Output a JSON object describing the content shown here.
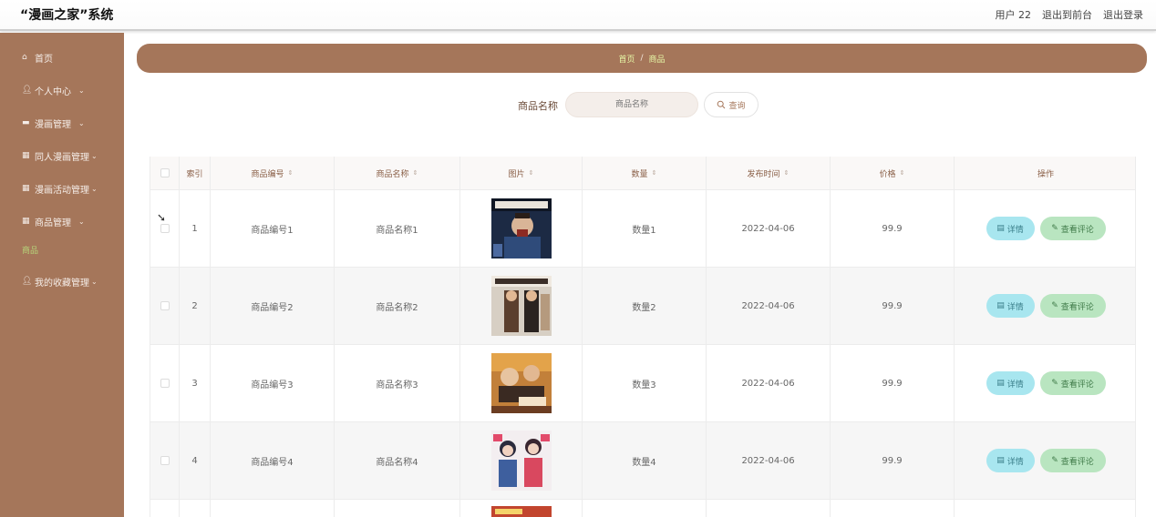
{
  "header": {
    "app_title": "“漫画之家”系统",
    "user_label": "用户 22",
    "back_to_admin": "退出到前台",
    "logout": "退出登录"
  },
  "sidebar": {
    "items": [
      {
        "label": "首页",
        "icon": "home-icon"
      },
      {
        "label": "个人中心",
        "icon": "user-icon",
        "chevron": "﹀"
      },
      {
        "label": "漫画管理",
        "icon": "book-icon",
        "chevron": "﹀"
      },
      {
        "label": "同人漫画管理",
        "icon": "grid-icon",
        "chevron": "﹀"
      },
      {
        "label": "漫画活动管理",
        "icon": "grid-icon",
        "chevron": "﹀"
      },
      {
        "label": "商品管理",
        "icon": "grid-icon",
        "chevron": "﹀"
      },
      {
        "label": "商品",
        "icon": ""
      },
      {
        "label": "我的收藏管理",
        "icon": "user-icon",
        "chevron": "﹀"
      }
    ]
  },
  "breadcrumb": {
    "home": "首页",
    "separator": "/",
    "current": "商品"
  },
  "search": {
    "label": "商品名称",
    "placeholder": "商品名称",
    "button": "查询"
  },
  "table": {
    "headers": [
      "索引",
      "商品编号",
      "商品名称",
      "图片",
      "数量",
      "发布时间",
      "价格",
      "操作"
    ],
    "rows": [
      {
        "index": "1",
        "code": "商品编号1",
        "name": "商品名称1",
        "qty": "数量1",
        "date": "2022-04-06",
        "price": "99.9"
      },
      {
        "index": "2",
        "code": "商品编号2",
        "name": "商品名称2",
        "qty": "数量2",
        "date": "2022-04-06",
        "price": "99.9"
      },
      {
        "index": "3",
        "code": "商品编号3",
        "name": "商品名称3",
        "qty": "数量3",
        "date": "2022-04-06",
        "price": "99.9"
      },
      {
        "index": "4",
        "code": "商品编号4",
        "name": "商品名称4",
        "qty": "数量4",
        "date": "2022-04-06",
        "price": "99.9"
      }
    ],
    "actions": {
      "detail": "详情",
      "review": "查看评论"
    }
  },
  "colors": {
    "brand": "#a5765a",
    "detail_btn": "#a8e6ef",
    "review_btn": "#b9e5c0"
  }
}
